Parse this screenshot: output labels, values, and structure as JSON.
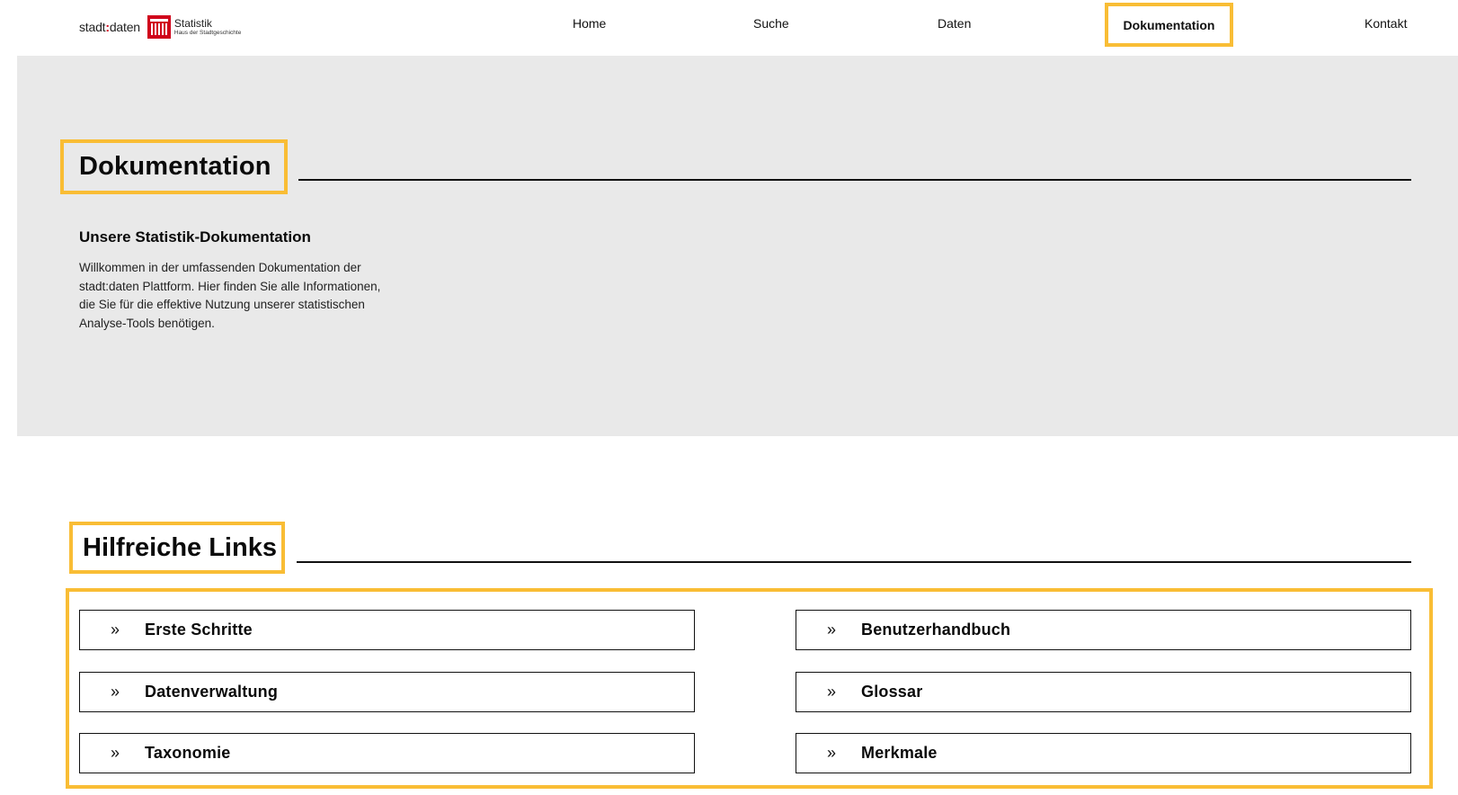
{
  "brand": {
    "wordmark_left": "stadt",
    "wordmark_colon": ":",
    "wordmark_right": "daten",
    "title": "Statistik",
    "subtitle": "Haus der Stadtgeschichte",
    "accent_color": "#d0021b"
  },
  "nav": {
    "items": [
      {
        "label": "Home"
      },
      {
        "label": "Suche"
      },
      {
        "label": "Daten"
      },
      {
        "label": "Dokumentation",
        "active": true
      },
      {
        "label": "Kontakt"
      }
    ]
  },
  "hero": {
    "title": "Dokumentation",
    "subtitle": "Unsere Statistik-Dokumentation",
    "text": "Willkommen in der umfassenden Dokumentation der stadt:daten Plattform. Hier finden Sie alle Informationen, die Sie für die effektive Nutzung unserer statistischen Analyse-Tools benötigen."
  },
  "links": {
    "title": "Hilfreiche Links",
    "icon": "double-chevron-right-icon",
    "items": [
      {
        "label": "Erste Schritte"
      },
      {
        "label": "Benutzerhandbuch"
      },
      {
        "label": "Datenverwaltung"
      },
      {
        "label": "Glossar"
      },
      {
        "label": "Taxonomie"
      },
      {
        "label": "Merkmale"
      }
    ]
  },
  "colors": {
    "highlight": "#f9bd35",
    "hero_background": "#e9e9e9"
  }
}
